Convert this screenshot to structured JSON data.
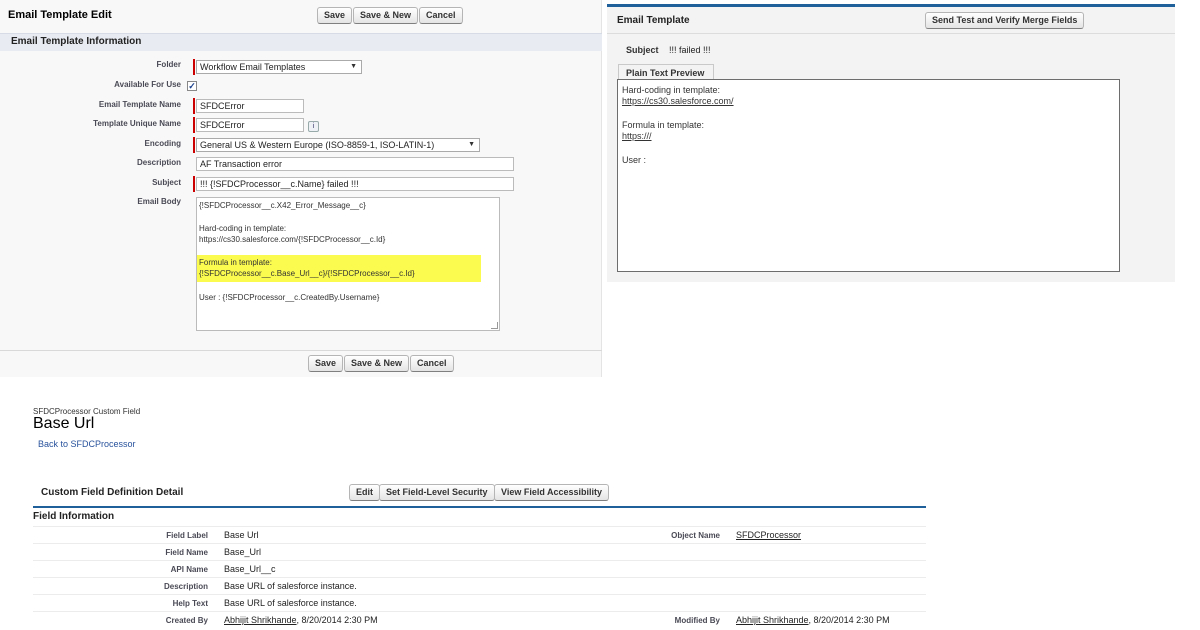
{
  "edit_panel": {
    "title": "Email Template Edit",
    "buttons": {
      "save": "Save",
      "save_new": "Save & New",
      "cancel": "Cancel"
    },
    "section_title": "Email Template Information",
    "fields": {
      "folder": {
        "label": "Folder",
        "value": "Workflow Email Templates"
      },
      "available": {
        "label": "Available For Use",
        "checked": true,
        "check_glyph": "✓"
      },
      "template_name": {
        "label": "Email Template Name",
        "value": "SFDCError"
      },
      "unique_name": {
        "label": "Template Unique Name",
        "value": "SFDCError",
        "info_glyph": "i"
      },
      "encoding": {
        "label": "Encoding",
        "value": "General US & Western Europe (ISO-8859-1, ISO-LATIN-1)"
      },
      "description": {
        "label": "Description",
        "value": "AF Transaction error"
      },
      "subject": {
        "label": "Subject",
        "value": "!!! {!SFDCProcessor__c.Name} failed !!!"
      },
      "email_body": {
        "label": "Email Body",
        "lines": [
          "{!SFDCProcessor__c.X42_Error_Message__c}",
          "Hard-coding in template:",
          "https://cs30.salesforce.com/{!SFDCProcessor__c.Id}",
          "Formula in template:",
          "{!SFDCProcessor__c.Base_Url__c}/{!SFDCProcessor__c.Id}",
          "User :  {!SFDCProcessor__c.CreatedBy.Username}"
        ],
        "highlight_color": "#fbfb4f"
      }
    },
    "select_arrow": "▼"
  },
  "preview_panel": {
    "title": "Email Template",
    "send_test_button": "Send Test and Verify Merge Fields",
    "subject_label": "Subject",
    "subject_value": "!!! failed !!!",
    "tab_label": "Plain Text Preview",
    "lines": {
      "hard_label": "Hard-coding in template:",
      "hard_link": "https://cs30.salesforce.com/",
      "formula_label": "Formula in template:",
      "formula_link": "https:///",
      "user_label": "User :"
    },
    "accent_color": "#1f5f9a"
  },
  "custom_field": {
    "subtitle": "SFDCProcessor Custom Field",
    "title": "Base Url",
    "back_link": "Back to SFDCProcessor",
    "detail_title": "Custom Field Definition Detail",
    "buttons": {
      "edit": "Edit",
      "field_security": "Set Field-Level Security",
      "field_accessibility": "View Field Accessibility"
    },
    "section_title": "Field Information",
    "rows": {
      "field_label": {
        "label": "Field Label",
        "value": "Base Url"
      },
      "field_name": {
        "label": "Field Name",
        "value": "Base_Url"
      },
      "api_name": {
        "label": "API Name",
        "value": "Base_Url__c"
      },
      "description": {
        "label": "Description",
        "value": "Base URL of salesforce instance."
      },
      "help_text": {
        "label": "Help Text",
        "value": "Base URL of salesforce instance."
      },
      "created_by": {
        "label": "Created By",
        "user": "Abhijit Shrikhande",
        "date": ", 8/20/2014 2:30 PM"
      },
      "object_name": {
        "label": "Object Name",
        "value": "SFDCProcessor"
      },
      "modified_by": {
        "label": "Modified By",
        "user": "Abhijit Shrikhande",
        "date": ", 8/20/2014 2:30 PM"
      }
    }
  }
}
